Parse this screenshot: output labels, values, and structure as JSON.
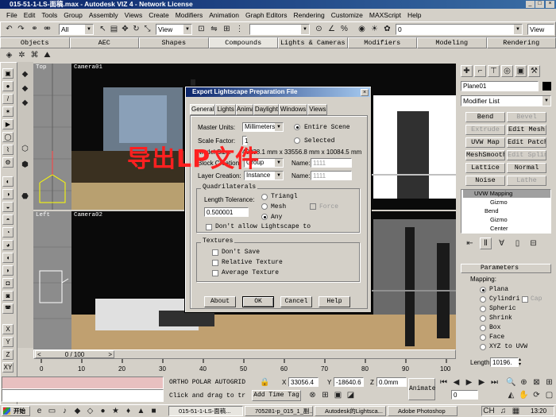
{
  "app": {
    "title": "015-51-1-LS-面稿.max - Autodesk VIZ 4 - Network License",
    "menu": [
      "File",
      "Edit",
      "Tools",
      "Group",
      "Assembly",
      "Views",
      "Create",
      "Modifiers",
      "Animation",
      "Graph Editors",
      "Rendering",
      "Customize",
      "MAXScript",
      "Help"
    ]
  },
  "toolbar": {
    "selection_filter": "All",
    "ref_coord": "View",
    "ref_coord2": "View",
    "named_sel": "0"
  },
  "tabs": [
    "Objects",
    "AEC",
    "Shapes",
    "Compounds",
    "Lights & Cameras",
    "Modifiers",
    "Modeling",
    "Rendering"
  ],
  "viewports": {
    "top": "Top",
    "camera1": "Camera01",
    "left": "Left",
    "camera2": "Camera02"
  },
  "watermark": "导出LP文件",
  "dialog": {
    "title": "Export Lightscape Preparation File",
    "tabs": [
      "General",
      "Lights",
      "Animation",
      "Daylight",
      "Windows",
      "Views"
    ],
    "master_units_label": "Master Units:",
    "master_units": "Millimeters",
    "scale_factor_label": "Scale Factor:",
    "scale_factor": "1",
    "model_size_label": "Model Size:",
    "model_size": "40238.1 mm x 33556.8 mm x 10084.5 mm",
    "block_creation_label": "Block Creation:",
    "block_creation": "Group",
    "layer_creation_label": "Layer Creation:",
    "layer_creation": "Instance",
    "entire_scene": "Entire Scene",
    "selected": "Selected",
    "name_label": "Name:",
    "name1": "1111",
    "name2": "1111",
    "quad_title": "Quadrilaterals",
    "length_tolerance_label": "Length Tolerance:",
    "length_tolerance": "0.500001",
    "triangle": "Triangl",
    "mesh": "Mesh",
    "any": "Any",
    "force": "Force",
    "dont_allow": "Don't allow Lightscape to",
    "textures_title": "Textures",
    "dont_save": "Don't Save",
    "relative_texture": "Relative Texture",
    "average_texture": "Average Texture",
    "about": "About",
    "ok": "OK",
    "cancel": "Cancel",
    "help": "Help"
  },
  "cmdpanel": {
    "object_name": "Plane01",
    "modifier_list": "Modifier List",
    "buttons": [
      [
        "Bend",
        "Bevel"
      ],
      [
        "Extrude",
        "Edit Mesh"
      ],
      [
        "UVW Map",
        "Edit Patch"
      ],
      [
        "MeshSmooth",
        "Edit Spline"
      ],
      [
        "Lattice",
        "Normal"
      ],
      [
        "Noise",
        "Lathe"
      ]
    ],
    "stack": [
      "UVW Mapping",
      "Gizmo",
      "Bend",
      "Gizmo",
      "Center"
    ],
    "params_title": "Parameters",
    "mapping_label": "Mapping:",
    "mapping_options": [
      "Plana",
      "Cylindri",
      "Spheric",
      "Shrink",
      "Box",
      "Face",
      "XYZ to UVW"
    ],
    "cap_label": "Cap",
    "length_label": "Length:",
    "length_value": "10196."
  },
  "timeline": {
    "frame_counter": "0 / 100",
    "ticks": [
      "0",
      "10",
      "20",
      "30",
      "40",
      "50",
      "60",
      "70",
      "80",
      "90",
      "100"
    ]
  },
  "status": {
    "modes": "ORTHO  POLAR  AUTOGRID",
    "x_label": "X",
    "x_value": "33056.4",
    "y_label": "Y",
    "y_value": "-18640.6",
    "z_label": "Z",
    "z_value": "0.0mm",
    "prompt": "Click and drag to tr",
    "add_time_tag": "Add Time Tag",
    "animate": "Animate",
    "frame": "0"
  },
  "taskbar": {
    "start": "开始",
    "items": [
      "015-51-1-LS-面稿...",
      "705281-p_015_1_副...",
      "Autodesk的Lightsca...",
      "Adobe Photoshop"
    ],
    "clock": "13:20"
  },
  "left_tools": [
    "X",
    "Y",
    "Z",
    "XY"
  ]
}
